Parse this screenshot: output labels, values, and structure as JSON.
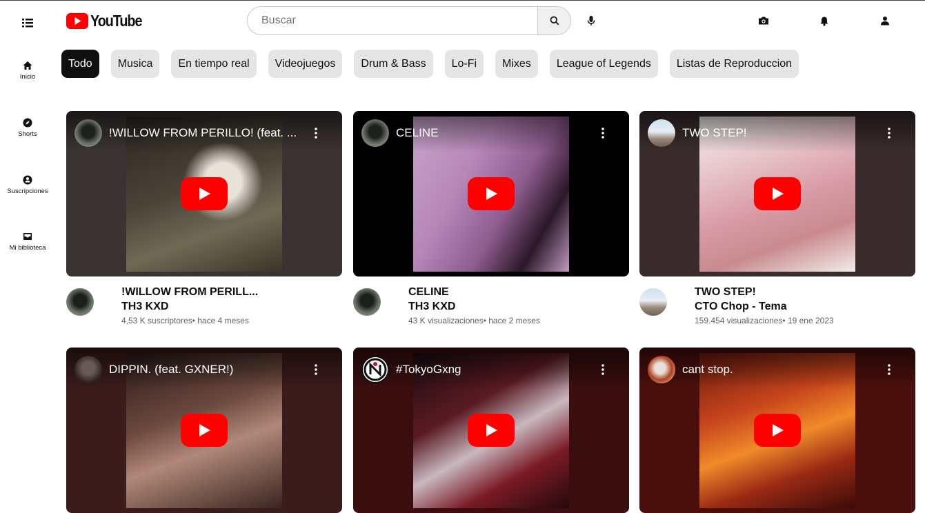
{
  "header": {
    "logo_text": "YouTube",
    "search_placeholder": "Buscar",
    "search_value": ""
  },
  "sidebar": {
    "items": [
      {
        "label": "Inicio",
        "icon": "home-icon"
      },
      {
        "label": "Shorts",
        "icon": "compass-icon"
      },
      {
        "label": "Suscripciones",
        "icon": "subscriptions-icon"
      },
      {
        "label": "Mi biblioteca",
        "icon": "library-icon"
      }
    ]
  },
  "chips": [
    "Todo",
    "Musica",
    "En tiempo real",
    "Videojuegos",
    "Drum & Bass",
    "Lo-Fi",
    "Mixes",
    "League of Legends",
    "Listas de Reproduccion"
  ],
  "active_chip": "Todo",
  "videos": [
    {
      "overlay_title": "!WILLOW FROM PERILLO! (feat. ...",
      "title": "!WILLOW FROM PERILL...",
      "channel": "TH3 KXD",
      "stats": "4,53 K suscriptores• hace 4 meses"
    },
    {
      "overlay_title": "CELINE",
      "title": "CELINE",
      "channel": "TH3 KXD",
      "stats": "43 K visualizaciones• hace 2 meses"
    },
    {
      "overlay_title": "TWO STEP!",
      "title": "TWO STEP!",
      "channel": "CTO Chop - Tema",
      "stats": "159.454 visualizaciones• 19 ene 2023"
    },
    {
      "overlay_title": "DIPPIN. (feat. GXNER!)"
    },
    {
      "overlay_title": "#TokyoGxng"
    },
    {
      "overlay_title": "cant stop."
    }
  ],
  "colors": {
    "brand_red": "#ff0000",
    "play_red": "#ff0000",
    "chip_bg": "#e5e5e5",
    "chip_active_bg": "#0f0f0f",
    "thumb_bg": [
      "#3b3332",
      "#000000",
      "#3a2c2c",
      "#3a1c1b",
      "#3a0e0e",
      "#4a0f0c"
    ]
  }
}
